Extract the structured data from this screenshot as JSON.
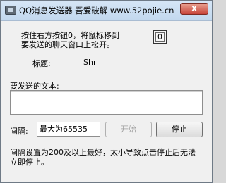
{
  "window": {
    "title": "QQ消息发送器 吾爱破解 www.52pojie.cn",
    "close_label": "X"
  },
  "main": {
    "instruction_line1": "按住右方按钮0，将鼠标移到",
    "instruction_line2": "要发送的聊天窗口上松开。",
    "capture_button_label": "0",
    "target_label": "标题:",
    "target_value": "Shr",
    "message_label": "要发送的文本:",
    "message_value": "",
    "interval_label": "间隔:",
    "interval_value": "最大为65535",
    "start_label": "开始",
    "stop_label": "停止",
    "note_line1": "间隔设置为200及以上最好，太小导致点击停止后无法",
    "note_line2": "立即停止。"
  }
}
